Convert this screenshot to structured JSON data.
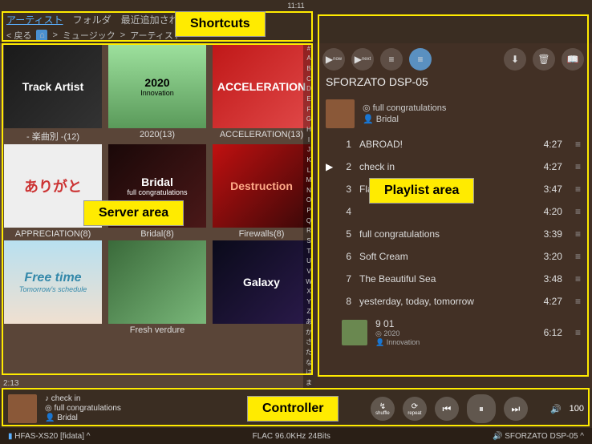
{
  "status": {
    "time": "11:11"
  },
  "callouts": {
    "shortcuts": "Shortcuts",
    "server": "Server area",
    "playlist": "Playlist area",
    "controller": "Controller"
  },
  "tabs": {
    "artist": "アーティスト",
    "folder": "フォルダ",
    "recent": "最近追加された"
  },
  "breadcrumb": {
    "back": "戻る",
    "music": "ミュージック",
    "artist": "アーティスト"
  },
  "alpha": [
    "#",
    "A",
    "B",
    "C",
    "D",
    "E",
    "F",
    "G",
    "H",
    "I",
    "J",
    "K",
    "L",
    "M",
    "N",
    "O",
    "P",
    "Q",
    "R",
    "S",
    "T",
    "U",
    "V",
    "W",
    "X",
    "Y",
    "Z",
    "あ",
    "か",
    "さ",
    "た",
    "な",
    "は",
    "ま"
  ],
  "albums": [
    {
      "title": "- 楽曲別 -(12)",
      "art": "Track Artist",
      "cls": "c1"
    },
    {
      "title": "2020(13)",
      "art": "2020",
      "cls": "c2",
      "sub": "Innovation"
    },
    {
      "title": "ACCELERATION(13)",
      "art": "ACCELERATION",
      "cls": "c3"
    },
    {
      "title": "APPRECIATION(8)",
      "art": "ありがと",
      "cls": "c4"
    },
    {
      "title": "Bridal(8)",
      "art": "Bridal",
      "cls": "c6",
      "sub": "full congratulations"
    },
    {
      "title": "Firewalls(8)",
      "art": "Destruction",
      "cls": "c7"
    },
    {
      "title": "",
      "art": "Free time",
      "cls": "c8",
      "sub": "Tomorrow's schedule"
    },
    {
      "title": "Fresh verdure",
      "art": "",
      "cls": "c9"
    },
    {
      "title": "",
      "art": "Galaxy",
      "cls": "c10"
    }
  ],
  "playlist": {
    "device": "SFORZATO DSP-05",
    "album": "full congratulations",
    "artist": "Bridal",
    "tracks": [
      {
        "n": "1",
        "name": "ABROAD!",
        "dur": "4:27"
      },
      {
        "n": "2",
        "name": "check in",
        "dur": "4:27",
        "playing": true
      },
      {
        "n": "3",
        "name": "Flash back",
        "dur": "3:47"
      },
      {
        "n": "4",
        "name": "",
        "dur": "4:20"
      },
      {
        "n": "5",
        "name": "full congratulations",
        "dur": "3:39"
      },
      {
        "n": "6",
        "name": "Soft Cream",
        "dur": "3:20"
      },
      {
        "n": "7",
        "name": "The Beautiful Sea",
        "dur": "3:48"
      },
      {
        "n": "8",
        "name": "yesterday, today, tomorrow",
        "dur": "4:27"
      },
      {
        "n": "9",
        "name": "01",
        "dur": "6:12",
        "sub1": "2020",
        "sub2": "Innovation",
        "art": true
      }
    ]
  },
  "controller": {
    "elapsed": "2:13",
    "track": "check in",
    "album": "full congratulations",
    "artist": "Bridal",
    "shuffle_icon": "↯",
    "shuffle": "shuffle",
    "repeat_icon": "⟳",
    "repeat": "repeat",
    "vol": "100"
  },
  "bottom": {
    "server": "HFAS-XS20 [fidata]",
    "format": "FLAC 96.0KHz 24Bits",
    "renderer": "SFORZATO DSP-05"
  },
  "icons": {
    "prev": "⏮",
    "pause": "⏸",
    "next": "⏭",
    "speaker": "🔊",
    "shuffle": "⇄",
    "chev": "^",
    "sep": ">",
    "disc": "◎",
    "hamburger": "≡",
    "play": "▶"
  }
}
